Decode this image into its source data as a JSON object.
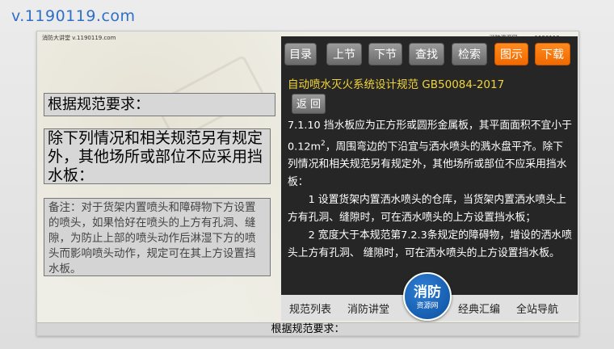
{
  "watermark": {
    "url": "v.1190119.com"
  },
  "slide": {
    "tiny_left": "消防大讲堂 v.1190119.com",
    "tiny_right": "消防资源网 www.1190119.com",
    "box1": "根据规范要求：",
    "box2": "除下列情况和相关规范另有规定外，其他场所或部位不应采用挡水板：",
    "box3": "备注：对于货架内置喷头和障碍物下方设置的喷头，如果恰好在喷头的上方有孔洞、缝隙，为防止上部的喷头动作后淋湿下方的喷头而影响喷头动作，规定可在其上方设置挡水板。"
  },
  "toolbar": {
    "buttons": [
      "目录",
      "上节",
      "下节",
      "查找",
      "检索",
      "图示",
      "下载"
    ]
  },
  "book": {
    "title": "自动喷水灭火系统设计规范 GB50084-2017",
    "back_label": "返 回",
    "para1a": "7.1.10 挡水板应为正方形或圆形金属板，其平面面积不宜小于0.12m",
    "para1_sup": "2",
    "para1b": "，周围弯边的下沿宜与洒水喷头的溅水盘平齐。除下列情况和相关规范另有规定外，其他场所或部位不应采用挡水板：",
    "para2": "　　1 设置货架内置洒水喷头的仓库，当货架内置洒水喷头上方有孔洞、缝隙时，可在洒水喷头的上方设置挡水板；",
    "para3": "　　2 宽度大于本规范第7.2.3条规定的障碍物，增设的洒水喷头上方有孔洞、 缝隙时，可在洒水喷头的上方设置挡水板。"
  },
  "bottom_nav": {
    "items": [
      "规范列表",
      "消防讲堂",
      "经典汇编",
      "全站导航"
    ],
    "logo_top": "消防",
    "logo_bottom": "资源网"
  },
  "subtitle": "根据规范要求：",
  "colors": {
    "accent_orange": "#f07a10",
    "title_yellow": "#f0d43a",
    "watermark_blue": "#2e6fc9"
  }
}
